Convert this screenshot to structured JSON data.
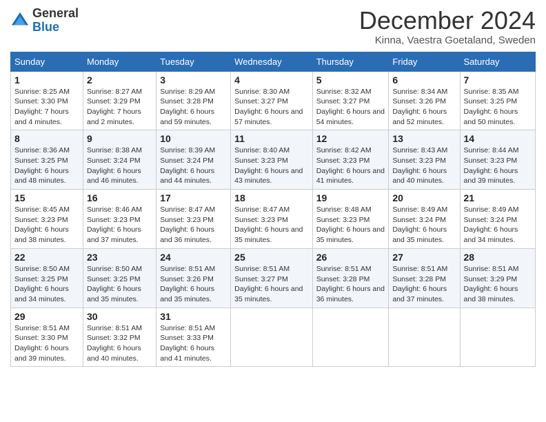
{
  "logo": {
    "general": "General",
    "blue": "Blue"
  },
  "title": "December 2024",
  "subtitle": "Kinna, Vaestra Goetaland, Sweden",
  "headers": [
    "Sunday",
    "Monday",
    "Tuesday",
    "Wednesday",
    "Thursday",
    "Friday",
    "Saturday"
  ],
  "weeks": [
    [
      {
        "day": "1",
        "info": "Sunrise: 8:25 AM\nSunset: 3:30 PM\nDaylight: 7 hours and 4 minutes."
      },
      {
        "day": "2",
        "info": "Sunrise: 8:27 AM\nSunset: 3:29 PM\nDaylight: 7 hours and 2 minutes."
      },
      {
        "day": "3",
        "info": "Sunrise: 8:29 AM\nSunset: 3:28 PM\nDaylight: 6 hours and 59 minutes."
      },
      {
        "day": "4",
        "info": "Sunrise: 8:30 AM\nSunset: 3:27 PM\nDaylight: 6 hours and 57 minutes."
      },
      {
        "day": "5",
        "info": "Sunrise: 8:32 AM\nSunset: 3:27 PM\nDaylight: 6 hours and 54 minutes."
      },
      {
        "day": "6",
        "info": "Sunrise: 8:34 AM\nSunset: 3:26 PM\nDaylight: 6 hours and 52 minutes."
      },
      {
        "day": "7",
        "info": "Sunrise: 8:35 AM\nSunset: 3:25 PM\nDaylight: 6 hours and 50 minutes."
      }
    ],
    [
      {
        "day": "8",
        "info": "Sunrise: 8:36 AM\nSunset: 3:25 PM\nDaylight: 6 hours and 48 minutes."
      },
      {
        "day": "9",
        "info": "Sunrise: 8:38 AM\nSunset: 3:24 PM\nDaylight: 6 hours and 46 minutes."
      },
      {
        "day": "10",
        "info": "Sunrise: 8:39 AM\nSunset: 3:24 PM\nDaylight: 6 hours and 44 minutes."
      },
      {
        "day": "11",
        "info": "Sunrise: 8:40 AM\nSunset: 3:23 PM\nDaylight: 6 hours and 43 minutes."
      },
      {
        "day": "12",
        "info": "Sunrise: 8:42 AM\nSunset: 3:23 PM\nDaylight: 6 hours and 41 minutes."
      },
      {
        "day": "13",
        "info": "Sunrise: 8:43 AM\nSunset: 3:23 PM\nDaylight: 6 hours and 40 minutes."
      },
      {
        "day": "14",
        "info": "Sunrise: 8:44 AM\nSunset: 3:23 PM\nDaylight: 6 hours and 39 minutes."
      }
    ],
    [
      {
        "day": "15",
        "info": "Sunrise: 8:45 AM\nSunset: 3:23 PM\nDaylight: 6 hours and 38 minutes."
      },
      {
        "day": "16",
        "info": "Sunrise: 8:46 AM\nSunset: 3:23 PM\nDaylight: 6 hours and 37 minutes."
      },
      {
        "day": "17",
        "info": "Sunrise: 8:47 AM\nSunset: 3:23 PM\nDaylight: 6 hours and 36 minutes."
      },
      {
        "day": "18",
        "info": "Sunrise: 8:47 AM\nSunset: 3:23 PM\nDaylight: 6 hours and 35 minutes."
      },
      {
        "day": "19",
        "info": "Sunrise: 8:48 AM\nSunset: 3:23 PM\nDaylight: 6 hours and 35 minutes."
      },
      {
        "day": "20",
        "info": "Sunrise: 8:49 AM\nSunset: 3:24 PM\nDaylight: 6 hours and 35 minutes."
      },
      {
        "day": "21",
        "info": "Sunrise: 8:49 AM\nSunset: 3:24 PM\nDaylight: 6 hours and 34 minutes."
      }
    ],
    [
      {
        "day": "22",
        "info": "Sunrise: 8:50 AM\nSunset: 3:25 PM\nDaylight: 6 hours and 34 minutes."
      },
      {
        "day": "23",
        "info": "Sunrise: 8:50 AM\nSunset: 3:25 PM\nDaylight: 6 hours and 35 minutes."
      },
      {
        "day": "24",
        "info": "Sunrise: 8:51 AM\nSunset: 3:26 PM\nDaylight: 6 hours and 35 minutes."
      },
      {
        "day": "25",
        "info": "Sunrise: 8:51 AM\nSunset: 3:27 PM\nDaylight: 6 hours and 35 minutes."
      },
      {
        "day": "26",
        "info": "Sunrise: 8:51 AM\nSunset: 3:28 PM\nDaylight: 6 hours and 36 minutes."
      },
      {
        "day": "27",
        "info": "Sunrise: 8:51 AM\nSunset: 3:28 PM\nDaylight: 6 hours and 37 minutes."
      },
      {
        "day": "28",
        "info": "Sunrise: 8:51 AM\nSunset: 3:29 PM\nDaylight: 6 hours and 38 minutes."
      }
    ],
    [
      {
        "day": "29",
        "info": "Sunrise: 8:51 AM\nSunset: 3:30 PM\nDaylight: 6 hours and 39 minutes."
      },
      {
        "day": "30",
        "info": "Sunrise: 8:51 AM\nSunset: 3:32 PM\nDaylight: 6 hours and 40 minutes."
      },
      {
        "day": "31",
        "info": "Sunrise: 8:51 AM\nSunset: 3:33 PM\nDaylight: 6 hours and 41 minutes."
      },
      null,
      null,
      null,
      null
    ]
  ]
}
